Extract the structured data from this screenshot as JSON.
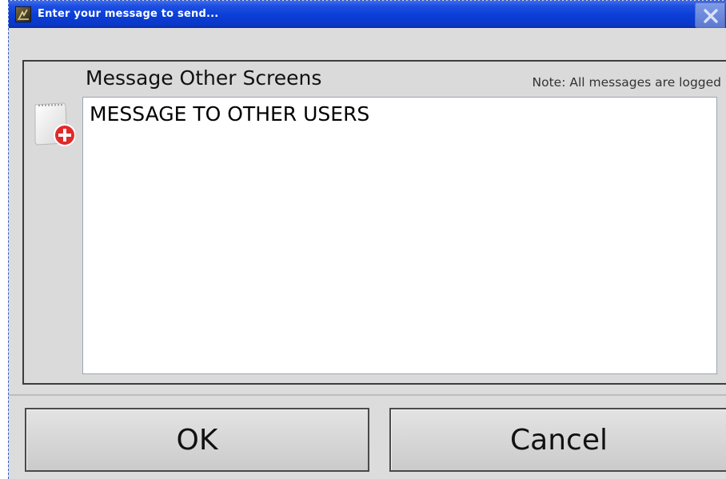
{
  "window": {
    "title": "Enter your message to send..."
  },
  "main": {
    "heading": "Message Other Screens",
    "note": "Note: All messages are logged",
    "message_value": "MESSAGE TO OTHER USERS"
  },
  "buttons": {
    "ok_label": "OK",
    "cancel_label": "Cancel"
  },
  "icons": {
    "app": "app-icon",
    "close": "close-icon",
    "message": "new-message-icon"
  },
  "colors": {
    "titlebar": "#0a3fd8",
    "panel_background": "#dadada",
    "add_badge": "#e02a2a"
  }
}
